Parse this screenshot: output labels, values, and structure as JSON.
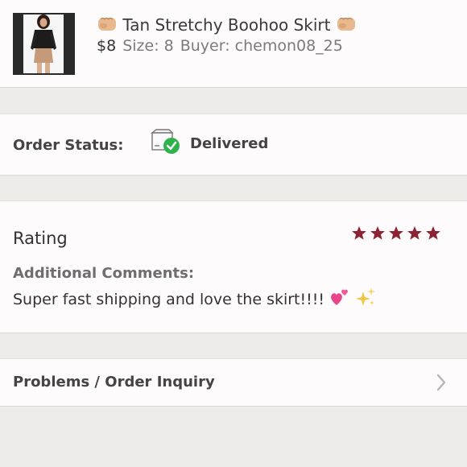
{
  "item": {
    "title": "Tan Stretchy Boohoo Skirt",
    "price": "$8",
    "size": "Size: 8",
    "buyer": "Buyer: chemon08_25",
    "thumbnail_icon": "product-photo",
    "title_icons": [
      "fist-emoji",
      "fist-emoji"
    ]
  },
  "order_status": {
    "label": "Order Status:",
    "value": "Delivered",
    "icon": "box-delivered-icon"
  },
  "rating": {
    "label": "Rating",
    "stars": 5,
    "max_stars": 5,
    "star_color": "#8b2332",
    "comments_label": "Additional Comments:",
    "comments_text": "Super fast shipping and love the skirt!!!!",
    "comment_emojis": [
      "two-hearts-emoji",
      "sparkles-emoji"
    ]
  },
  "problems": {
    "label": "Problems / Order Inquiry",
    "icon": "chevron-right-icon"
  },
  "colors": {
    "background": "#edebe8",
    "card": "#fdfbfc",
    "delivered_check": "#2db34a",
    "star": "#8b2332"
  }
}
